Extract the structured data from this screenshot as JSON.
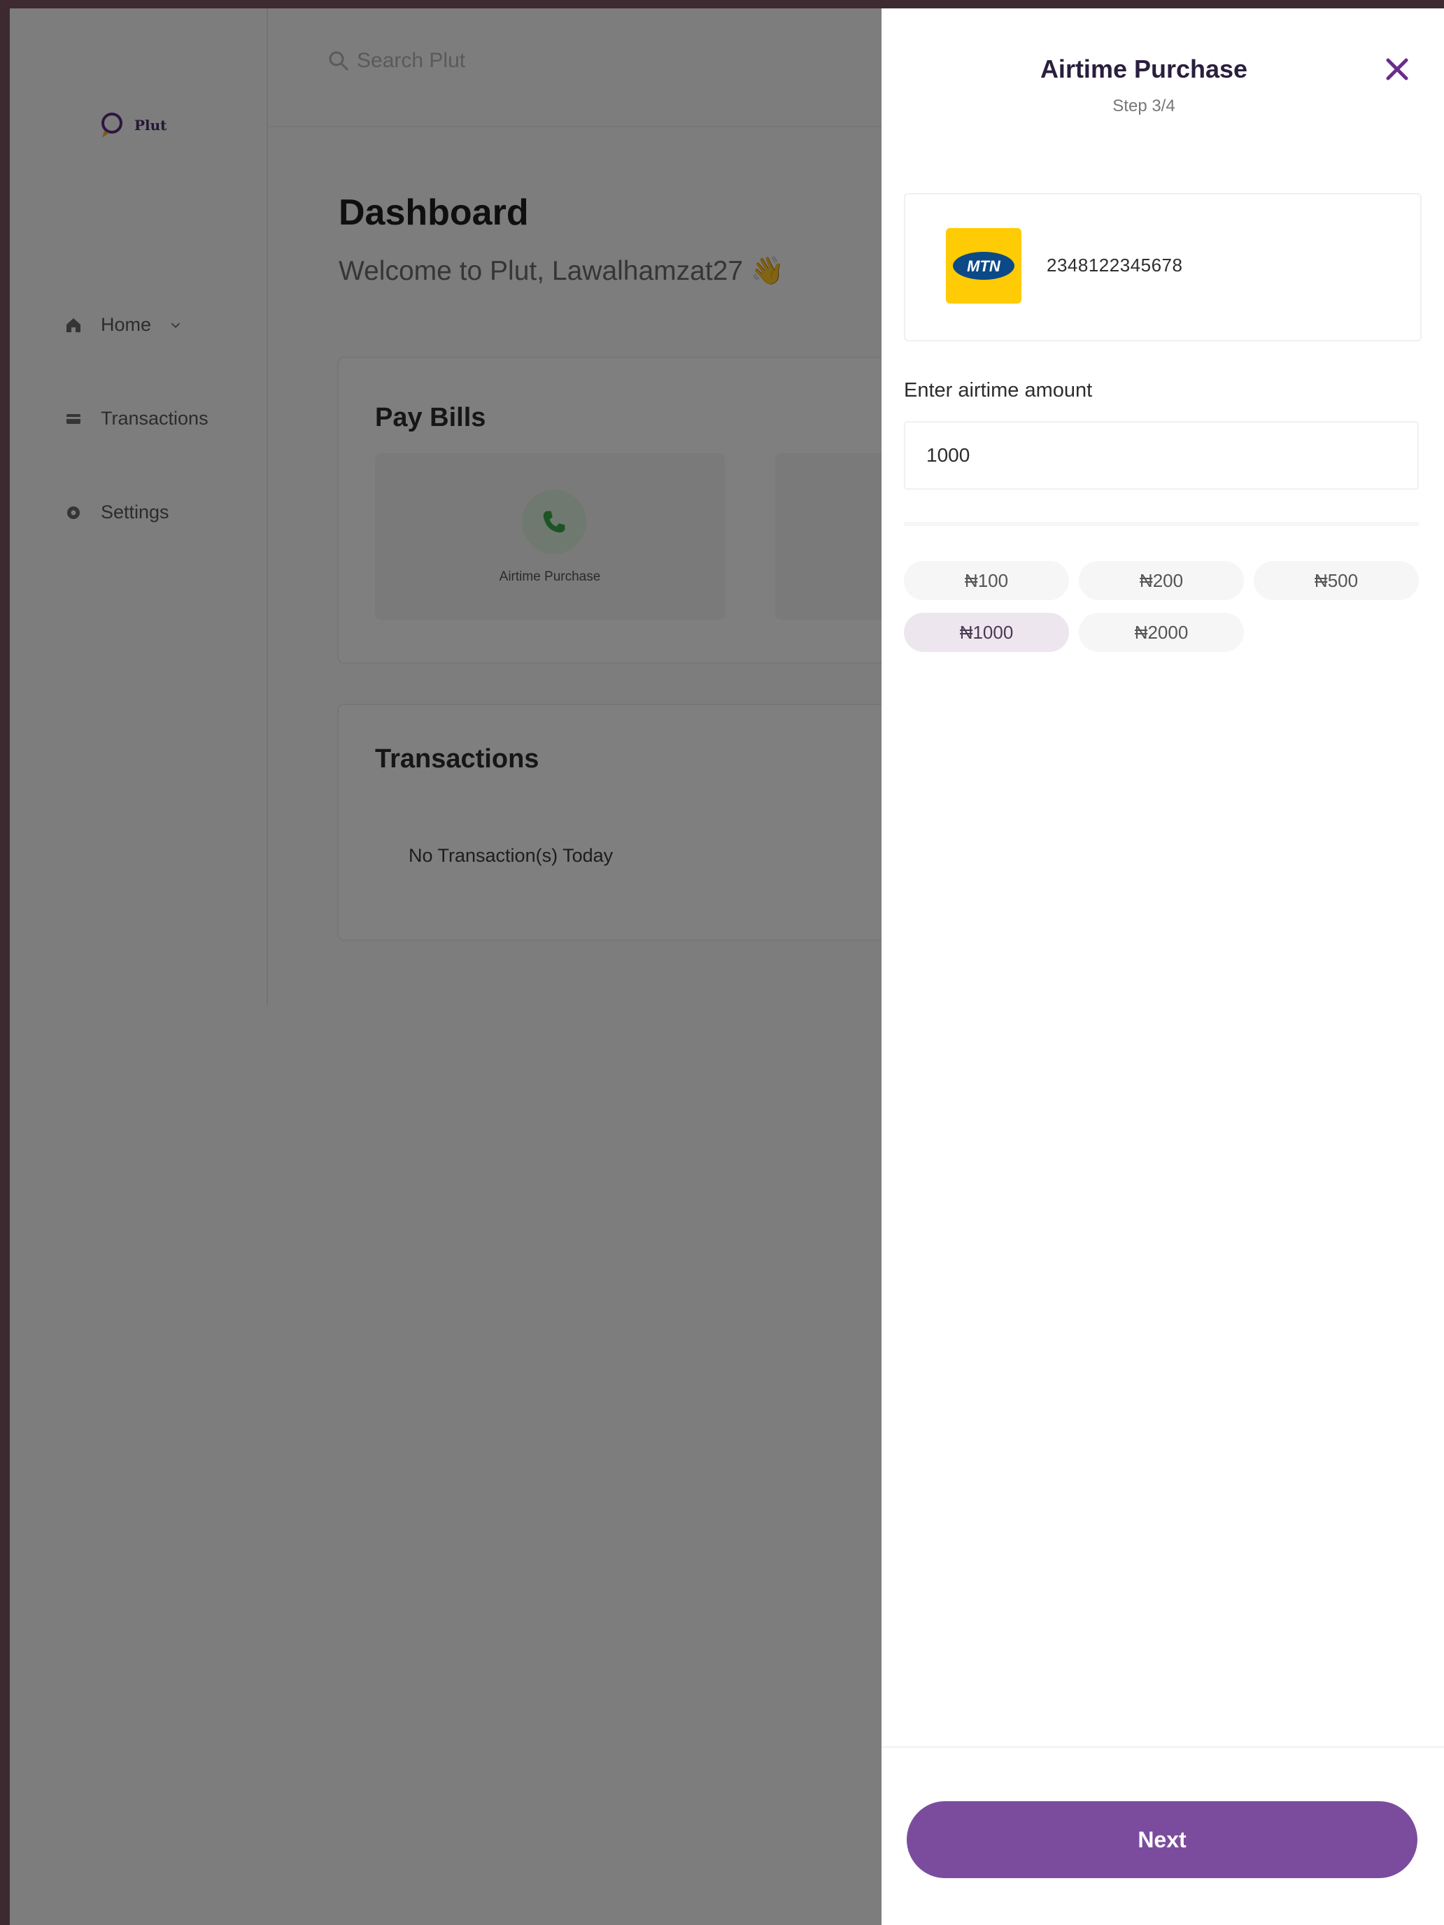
{
  "app": {
    "brand": "Plut",
    "search_placeholder": "Search Plut"
  },
  "sidebar": {
    "items": [
      {
        "label": "Home",
        "icon": "home-icon"
      },
      {
        "label": "Transactions",
        "icon": "card-icon"
      },
      {
        "label": "Settings",
        "icon": "gear-icon"
      }
    ]
  },
  "dashboard": {
    "title": "Dashboard",
    "welcome": "Welcome to Plut, Lawalhamzat27 👋",
    "pay_bills": {
      "title": "Pay Bills",
      "tiles": [
        {
          "label": "Airtime Purchase",
          "icon": "phone-icon"
        }
      ]
    },
    "transactions": {
      "title": "Transactions",
      "empty": "No Transaction(s) Today"
    }
  },
  "panel": {
    "title": "Airtime Purchase",
    "step": "Step 3/4",
    "network": {
      "name": "MTN",
      "phone": "2348122345678",
      "color": "#ffcb05"
    },
    "amount_label": "Enter airtime amount",
    "amount_value": "1000",
    "presets": [
      {
        "label": "₦100",
        "selected": false
      },
      {
        "label": "₦200",
        "selected": false
      },
      {
        "label": "₦500",
        "selected": false
      },
      {
        "label": "₦1000",
        "selected": true
      },
      {
        "label": "₦2000",
        "selected": false
      }
    ],
    "next_label": "Next"
  },
  "colors": {
    "accent": "#7b4c9e",
    "close": "#6a2d8c"
  }
}
